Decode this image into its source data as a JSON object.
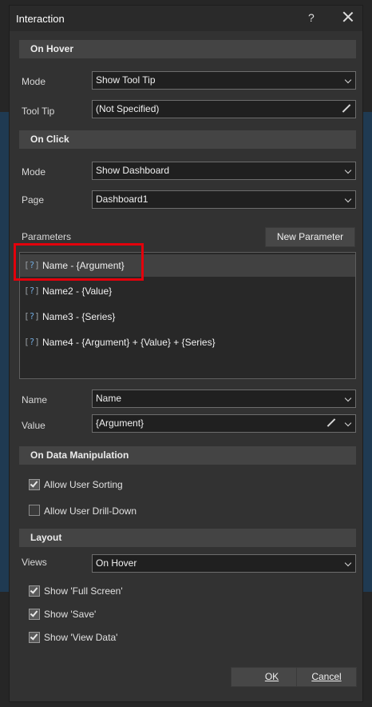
{
  "window": {
    "title": "Interaction",
    "help_label": "?"
  },
  "on_hover": {
    "header": "On Hover",
    "mode_label": "Mode",
    "mode_value": "Show Tool Tip",
    "tooltip_label": "Tool Tip",
    "tooltip_value": "(Not Specified)"
  },
  "on_click": {
    "header": "On Click",
    "mode_label": "Mode",
    "mode_value": "Show Dashboard",
    "page_label": "Page",
    "page_value": "Dashboard1",
    "parameters_label": "Parameters",
    "new_parameter_label": "New Parameter",
    "parameters": [
      {
        "icon": "[?]",
        "text": "Name - {Argument}",
        "selected": true
      },
      {
        "icon": "[?]",
        "text": "Name2 - {Value}"
      },
      {
        "icon": "[?]",
        "text": "Name3 - {Series}"
      },
      {
        "icon": "[?]",
        "text": "Name4 - {Argument} + {Value} + {Series}"
      }
    ],
    "name_label": "Name",
    "name_value": "Name",
    "value_label": "Value",
    "value_value": "{Argument}"
  },
  "on_data_manipulation": {
    "header": "On Data Manipulation",
    "allow_user_sorting": {
      "label": "Allow User Sorting",
      "checked": true
    },
    "allow_user_drilldown": {
      "label": "Allow User Drill-Down",
      "checked": false
    }
  },
  "layout": {
    "header": "Layout",
    "views_label": "Views",
    "views_value": "On Hover",
    "show_full_screen": {
      "label": "Show 'Full Screen'",
      "checked": true
    },
    "show_save": {
      "label": "Show 'Save'",
      "checked": true
    },
    "show_view_data": {
      "label": "Show 'View Data'",
      "checked": true
    }
  },
  "buttons": {
    "ok": "OK",
    "cancel": "Cancel"
  },
  "colors": {
    "highlight": "#e3000b",
    "accent": "#6fa8dc",
    "background": "#323232"
  }
}
